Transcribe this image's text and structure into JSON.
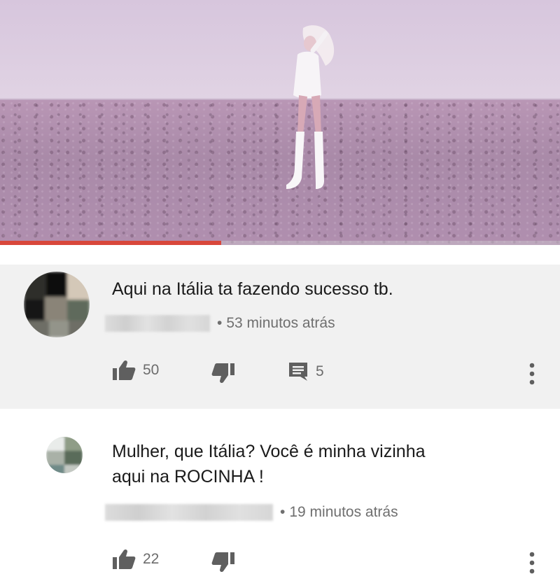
{
  "video": {
    "progress_fraction": 0.395
  },
  "comments": [
    {
      "text": "Aqui na Itália ta fazendo sucesso tb.",
      "time": "53 minutos atrás",
      "likes": "50",
      "replies": "5",
      "icons": [
        "thumbs-up-icon",
        "thumbs-down-icon",
        "reply-icon",
        "more-vert-icon"
      ]
    },
    {
      "text_line1": "Mulher, que Itália? Você é minha vizinha",
      "text_line2": "aqui na ROCINHA !",
      "time": "19 minutos atrás",
      "likes": "22",
      "icons": [
        "thumbs-up-icon",
        "thumbs-down-icon",
        "more-vert-icon"
      ]
    }
  ],
  "colors": {
    "progress": "#d8473b",
    "comment_bg": "#f1f1f1",
    "icon": "#5f5f5f"
  }
}
